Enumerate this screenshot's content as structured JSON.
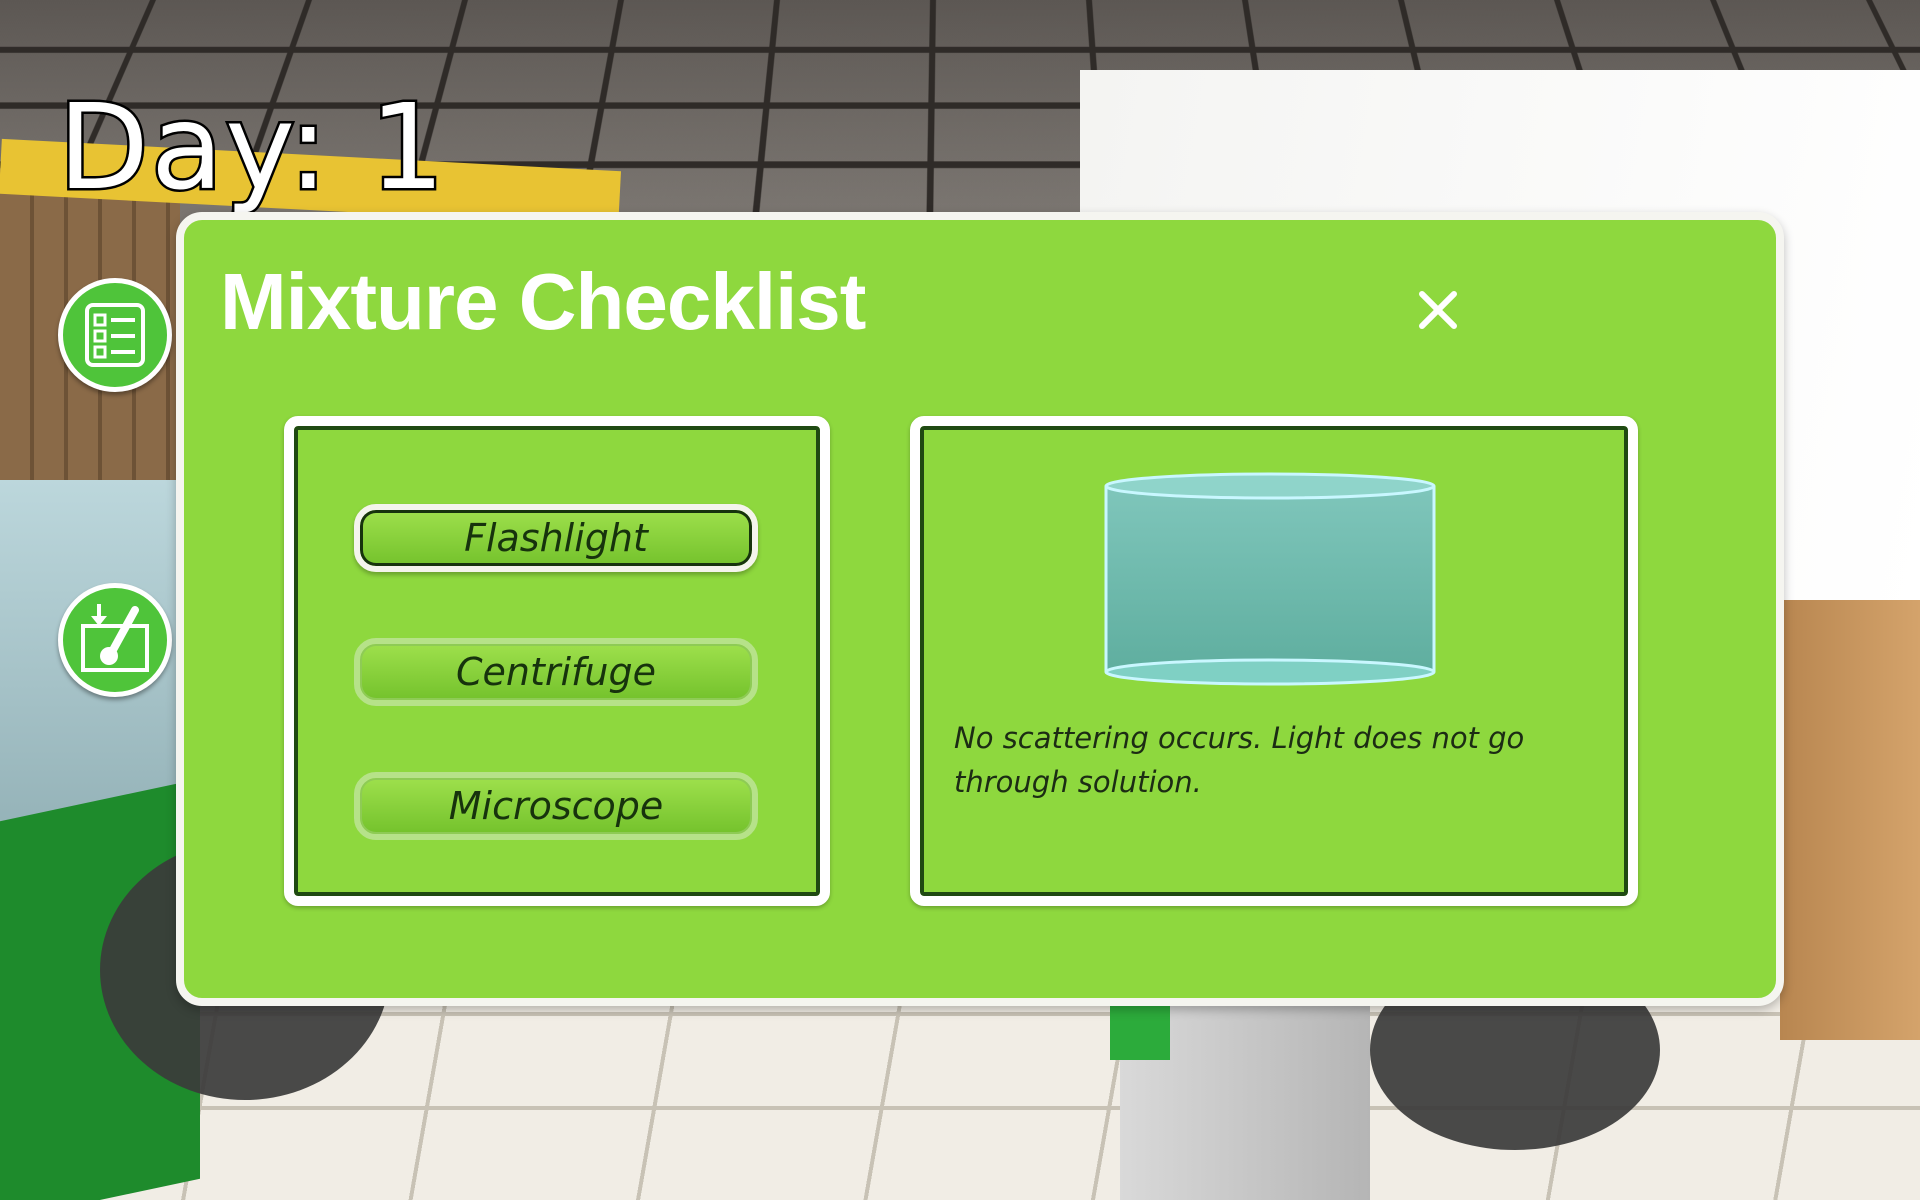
{
  "hud": {
    "day_text": "Day: 1",
    "side_buttons": [
      {
        "icon": "checklist-icon"
      },
      {
        "icon": "sample-tray-icon"
      }
    ]
  },
  "dialog": {
    "title": "Mixture Checklist",
    "close_icon": "close-icon",
    "tools": [
      {
        "label": "Flashlight",
        "state": "selected"
      },
      {
        "label": "Centrifuge",
        "state": "unselected"
      },
      {
        "label": "Microscope",
        "state": "unselected"
      }
    ],
    "result": {
      "image": "beaker-solution",
      "text": "No scattering occurs. Light does not go through solution."
    }
  },
  "colors": {
    "panel_green": "#8ed83e",
    "button_green": "#4fc43a",
    "outline_dark": "#1f4a12"
  }
}
